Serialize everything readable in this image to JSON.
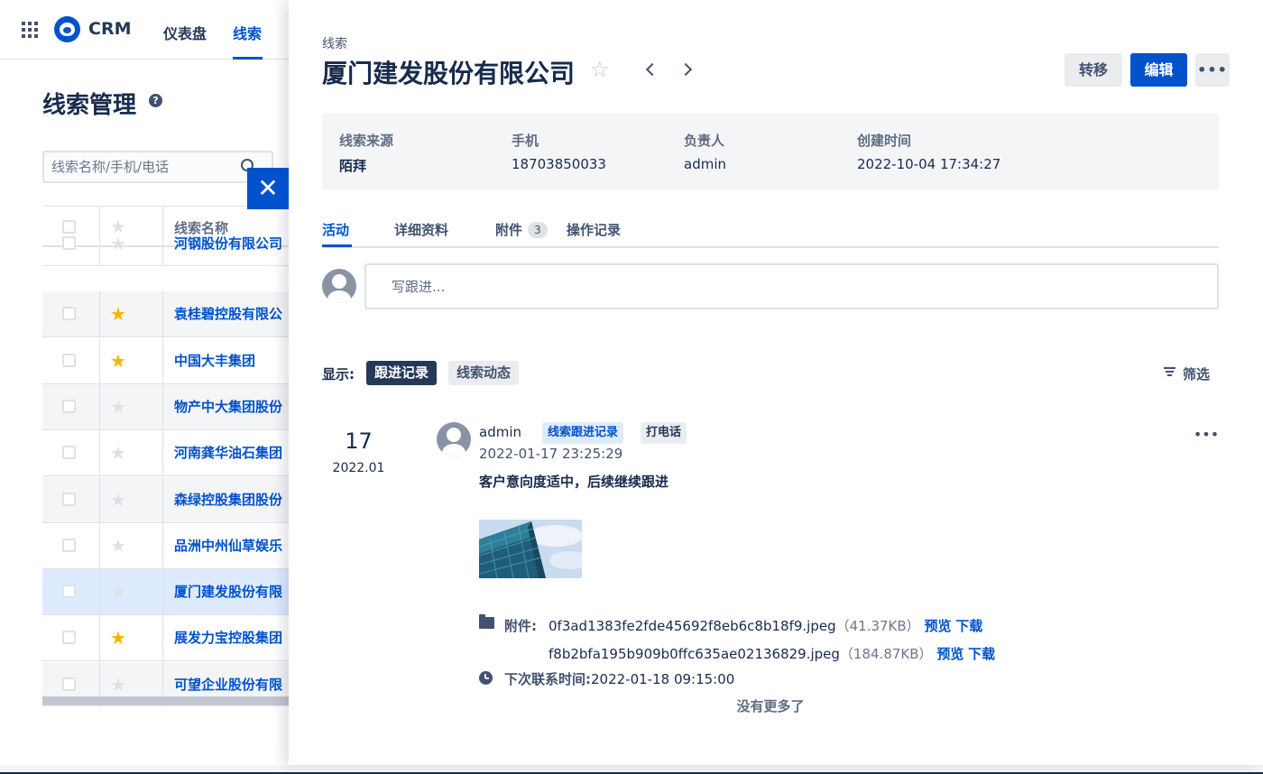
{
  "app": {
    "brand": "CRM"
  },
  "nav": {
    "items": [
      "仪表盘",
      "线索"
    ]
  },
  "page": {
    "title": "线索管理",
    "help": "?"
  },
  "search": {
    "placeholder": "线索名称/手机/电话"
  },
  "table": {
    "header_name": "线索名称",
    "rows": [
      {
        "name": "河钢股份有限公司",
        "starred": false
      },
      {
        "name": "袁桂碧控股有限公",
        "starred": true
      },
      {
        "name": "中国大丰集团",
        "starred": true
      },
      {
        "name": "物产中大集团股份",
        "starred": false
      },
      {
        "name": "河南龚华油石集团",
        "starred": false
      },
      {
        "name": "森绿控股集团股份",
        "starred": false
      },
      {
        "name": "品洲中州仙草娱乐",
        "starred": false
      },
      {
        "name": "厦门建发股份有限",
        "starred": false,
        "selected": true
      },
      {
        "name": "展发力宝控股集团",
        "starred": true
      },
      {
        "name": "可望企业股份有限",
        "starred": false
      }
    ]
  },
  "drawer": {
    "breadcrumb": "线索",
    "title": "厦门建发股份有限公司",
    "transfer_label": "转移",
    "edit_label": "编辑",
    "more_label": "•••",
    "info": [
      {
        "label": "线索来源",
        "value": "陌拜"
      },
      {
        "label": "手机",
        "value": "18703850033"
      },
      {
        "label": "负责人",
        "value": "admin"
      },
      {
        "label": "创建时间",
        "value": "2022-10-04 17:34:27"
      }
    ],
    "tabs": [
      {
        "label": "活动"
      },
      {
        "label": "详细资料"
      },
      {
        "label": "附件",
        "badge": "3"
      },
      {
        "label": "操作记录"
      }
    ],
    "compose_placeholder": "写跟进...",
    "show_label": "显示:",
    "filters": [
      "跟进记录",
      "线索动态"
    ],
    "filter_label": "筛选",
    "activity": {
      "day": "17",
      "year_month": "2022.01",
      "user": "admin",
      "tags": [
        "线索跟进记录",
        "打电话"
      ],
      "time": "2022-01-17 23:25:29",
      "content": "客户意向度适中，后续继续跟进",
      "more_label": "•••",
      "attachment_label": "附件:",
      "attachments": [
        {
          "file": "0f3ad1383fe2fde45692f8eb6c8b18f9.jpeg",
          "size": "（41.37KB）"
        },
        {
          "file": "f8b2bfa195b909b0ffc635ae02136829.jpeg",
          "size": "（184.87KB）"
        }
      ],
      "preview_label": "预览",
      "download_label": "下载",
      "next_contact_label": "下次联系时间:",
      "next_contact_value": "2022-01-18 09:15:00"
    },
    "no_more": "没有更多了"
  },
  "colors": {
    "accent": "#0052cc",
    "star": "#f4b400",
    "dark_chip": "#253858"
  }
}
